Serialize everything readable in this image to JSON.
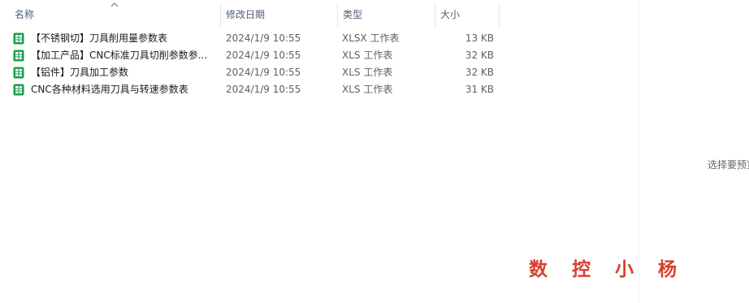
{
  "columns": {
    "name": "名称",
    "modified": "修改日期",
    "type": "类型",
    "size": "大小"
  },
  "sort": {
    "column": "name",
    "direction": "ascending",
    "icon": "chevron-up-icon"
  },
  "files": [
    {
      "name": "【不锈钢切】刀具削用量参数表",
      "modified": "2024/1/9 10:55",
      "type": "XLSX 工作表",
      "size": "13 KB",
      "icon": "spreadsheet-icon"
    },
    {
      "name": "【加工产品】CNC标准刀具切削参数参...",
      "modified": "2024/1/9 10:55",
      "type": "XLS 工作表",
      "size": "32 KB",
      "icon": "spreadsheet-icon"
    },
    {
      "name": "【铝件】刀具加工参数",
      "modified": "2024/1/9 10:55",
      "type": "XLS 工作表",
      "size": "32 KB",
      "icon": "spreadsheet-icon"
    },
    {
      "name": "CNC各种材料选用刀具与转速参数表",
      "modified": "2024/1/9 10:55",
      "type": "XLS 工作表",
      "size": "31 KB",
      "icon": "spreadsheet-icon"
    }
  ],
  "preview": {
    "message": "选择要预览"
  },
  "watermark": {
    "text": "数控小杨"
  },
  "colors": {
    "icon_green": "#1e9e4a",
    "watermark_red": "#d7402a",
    "header_text": "#4c607a"
  }
}
